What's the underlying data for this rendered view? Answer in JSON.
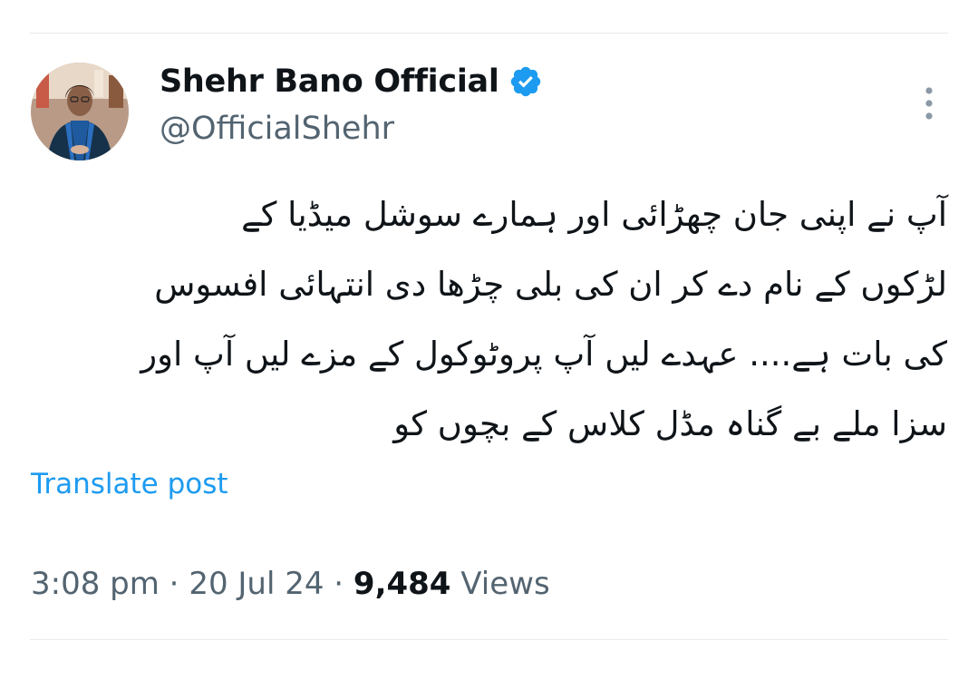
{
  "post": {
    "author": {
      "display_name": "Shehr Bano Official",
      "handle": "@OfficialShehr",
      "verified": true,
      "verified_icon": "verified-badge-icon",
      "avatar": "profile-photo"
    },
    "text_lines": [
      "آپ نے اپنی جان چھڑائی اور ہمارے سوشل میڈیا کے",
      "لڑکوں کے نام دے کر ان کی بلی چڑھا دی انتہائی افسوس",
      "کی بات ہے.... عہدے لیں آپ پروٹوکول کے مزے لیں آپ اور",
      "سزا ملے بے گناہ مڈل کلاس کے بچوں کو"
    ],
    "translate_label": "Translate post",
    "meta": {
      "time": "3:08 pm",
      "separator": " · ",
      "date": "20 Jul 24",
      "views_count": "9,484",
      "views_label": " Views"
    },
    "more_icon": "more-vertical-icon"
  },
  "colors": {
    "text": "#0f1419",
    "secondary": "#536471",
    "accent": "#1d9bf0",
    "divider": "#e6e9ec"
  }
}
